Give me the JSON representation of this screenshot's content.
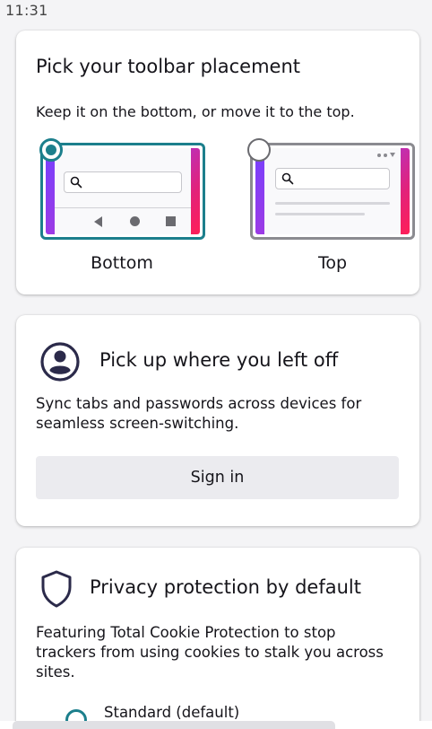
{
  "status_bar": {
    "time": "11:31"
  },
  "toolbar_card": {
    "title": "Pick your toolbar placement",
    "description": "Keep it on the bottom, or move it to the top.",
    "options": [
      {
        "label": "Bottom",
        "selected": true
      },
      {
        "label": "Top",
        "selected": false
      }
    ]
  },
  "sync_card": {
    "icon": "account-circle-icon",
    "title": "Pick up where you left off",
    "description": "Sync tabs and passwords across devices for seamless screen-switching.",
    "button_label": "Sign in"
  },
  "privacy_card": {
    "icon": "shield-icon",
    "title": "Privacy protection by default",
    "description": "Featuring Total Cookie Protection to stop trackers from using cookies to stalk you across sites.",
    "option_label": "Standard (default)"
  },
  "colors": {
    "accent": "#1c7f8c",
    "gradient": [
      "#7540ff",
      "#a33ae0",
      "#e2227a",
      "#ff1f57"
    ],
    "button_bg": "#ebebef"
  }
}
